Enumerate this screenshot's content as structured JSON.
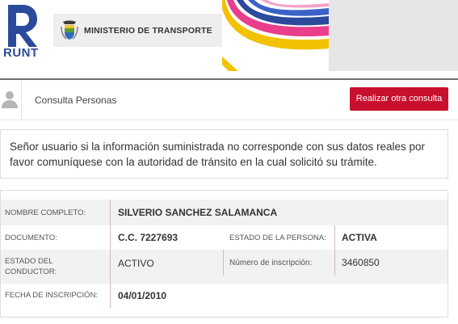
{
  "header": {
    "logo_text": "RUNT",
    "ministry_text": "MINISTERIO DE TRANSPORTE"
  },
  "consulta": {
    "title": "Consulta Personas",
    "button_label": "Realizar otra consulta"
  },
  "notice": {
    "text": "Señor usuario si la información suministrada no corresponde con sus datos reales por favor comuníquese con la autoridad de tránsito en la cual solicitó su trámite."
  },
  "person": {
    "nombre_label": "NOMBRE COMPLETO:",
    "nombre_value": "SILVERIO SANCHEZ SALAMANCA",
    "documento_label": "DOCUMENTO:",
    "documento_value": "C.C. 7227693",
    "estado_persona_label": "ESTADO DE LA PERSONA:",
    "estado_persona_value": "ACTIVA",
    "estado_conductor_label": "ESTADO DEL CONDUCTOR:",
    "estado_conductor_value": "ACTIVO",
    "inscripcion_label": "Número de inscripción:",
    "inscripcion_value": "3460850",
    "fecha_label": "FECHA DE INSCRIPCIÓN:",
    "fecha_value": "04/01/2010"
  },
  "colors": {
    "accent_red": "#c8102e",
    "runt_blue": "#2c4a9c"
  },
  "icons": [
    "runt-logo-icon",
    "coat-of-arms-icon",
    "decorative-waves",
    "person-icon"
  ]
}
